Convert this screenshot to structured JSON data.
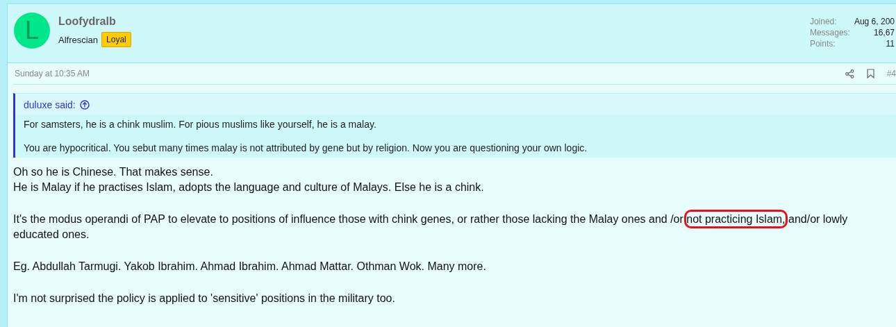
{
  "author": {
    "avatar_letter": "L",
    "name": "Loofydralb",
    "title": "Alfrescian",
    "badge": "Loyal"
  },
  "stats": [
    {
      "label": "Joined:",
      "value": "Aug 6, 200"
    },
    {
      "label": "Messages:",
      "value": "16,67"
    },
    {
      "label": "Points:",
      "value": "11"
    }
  ],
  "post_time": "Sunday at 10:35 AM",
  "post_number": "#4",
  "quote": {
    "attribution": "duluxe said:",
    "paragraphs": [
      "For samsters, he is a chink muslim. For pious muslims like yourself, he is a malay.",
      "You are hypocritical. You sebut many times malay is not attributed by gene but by religion. Now you are questioning your own logic."
    ]
  },
  "body": [
    {
      "lines": [
        "Oh so he is Chinese. That makes sense.",
        "He is Malay if he practises Islam, adopts the language and culture of Malays. Else he is a chink."
      ]
    },
    {
      "before": "It's the modus operandi of PAP to elevate to positions of influence those with chink genes, or rather those lacking the Malay ones and /or ",
      "circled": "not practicing Islam,",
      "after": " and/or lowly educated ones."
    },
    {
      "lines": [
        "Eg. Abdullah Tarmugi. Yakob Ibrahim. Ahmad Ibrahim. Ahmad Mattar. Othman Wok. Many more."
      ]
    },
    {
      "lines": [
        "I'm not surprised the policy is applied to 'sensitive' positions in the military too."
      ]
    }
  ]
}
